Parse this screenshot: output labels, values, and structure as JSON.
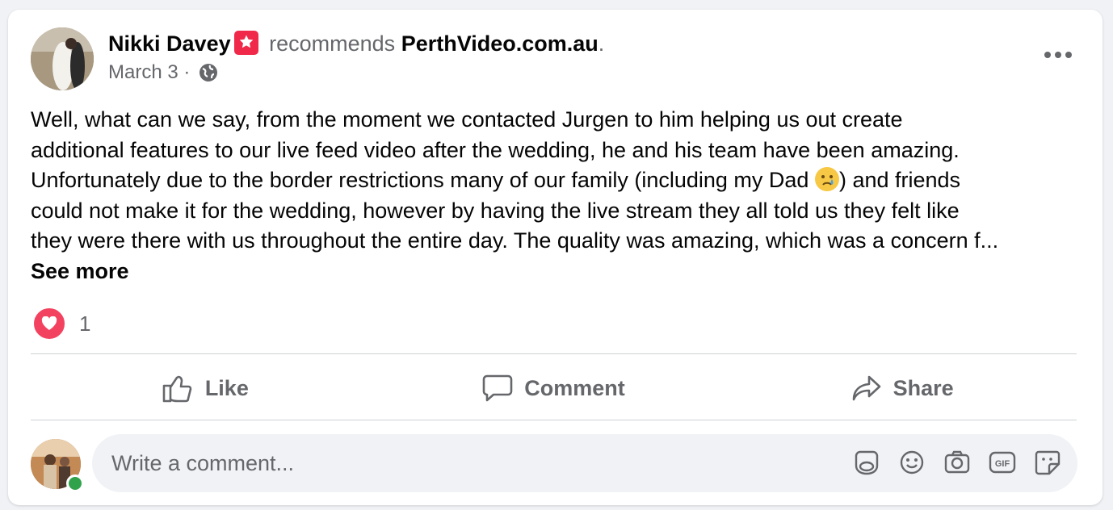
{
  "post": {
    "author": "Nikki Davey",
    "recommends_text": "recommends",
    "page_name": "PerthVideo.com.au",
    "period": ".",
    "date": "March 3",
    "date_sep": " · ",
    "body_lines": [
      "Well, what can we say, from the moment we contacted Jurgen to him helping us out create",
      "additional features to our live feed video after the wedding, he and his team have been amazing.",
      "Unfortunately due to the border restrictions many of our family (including my Dad",
      ") and friends",
      "could not make it for the wedding, however by having the live stream they all told us they felt like",
      "they were there with us throughout the entire day. The quality was amazing, which was a concern f..."
    ],
    "see_more": "See more",
    "reaction_count": "1"
  },
  "actions": {
    "like": "Like",
    "comment": "Comment",
    "share": "Share"
  },
  "comment_box": {
    "placeholder": "Write a comment..."
  },
  "icons": {
    "recommend_badge": "star-badge-icon",
    "audience": "globe-icon",
    "options": "more-options-icon",
    "reaction": "heart-reaction-icon",
    "emoji_in_text": "crying-face-emoji",
    "comment_tools": [
      "avatar-sticker-icon",
      "emoji-icon",
      "camera-icon",
      "gif-icon",
      "sticker-icon"
    ]
  },
  "colors": {
    "badge": "#f02849",
    "heart": "#f3425f",
    "online": "#31a24c",
    "muted_text": "#65676b"
  }
}
